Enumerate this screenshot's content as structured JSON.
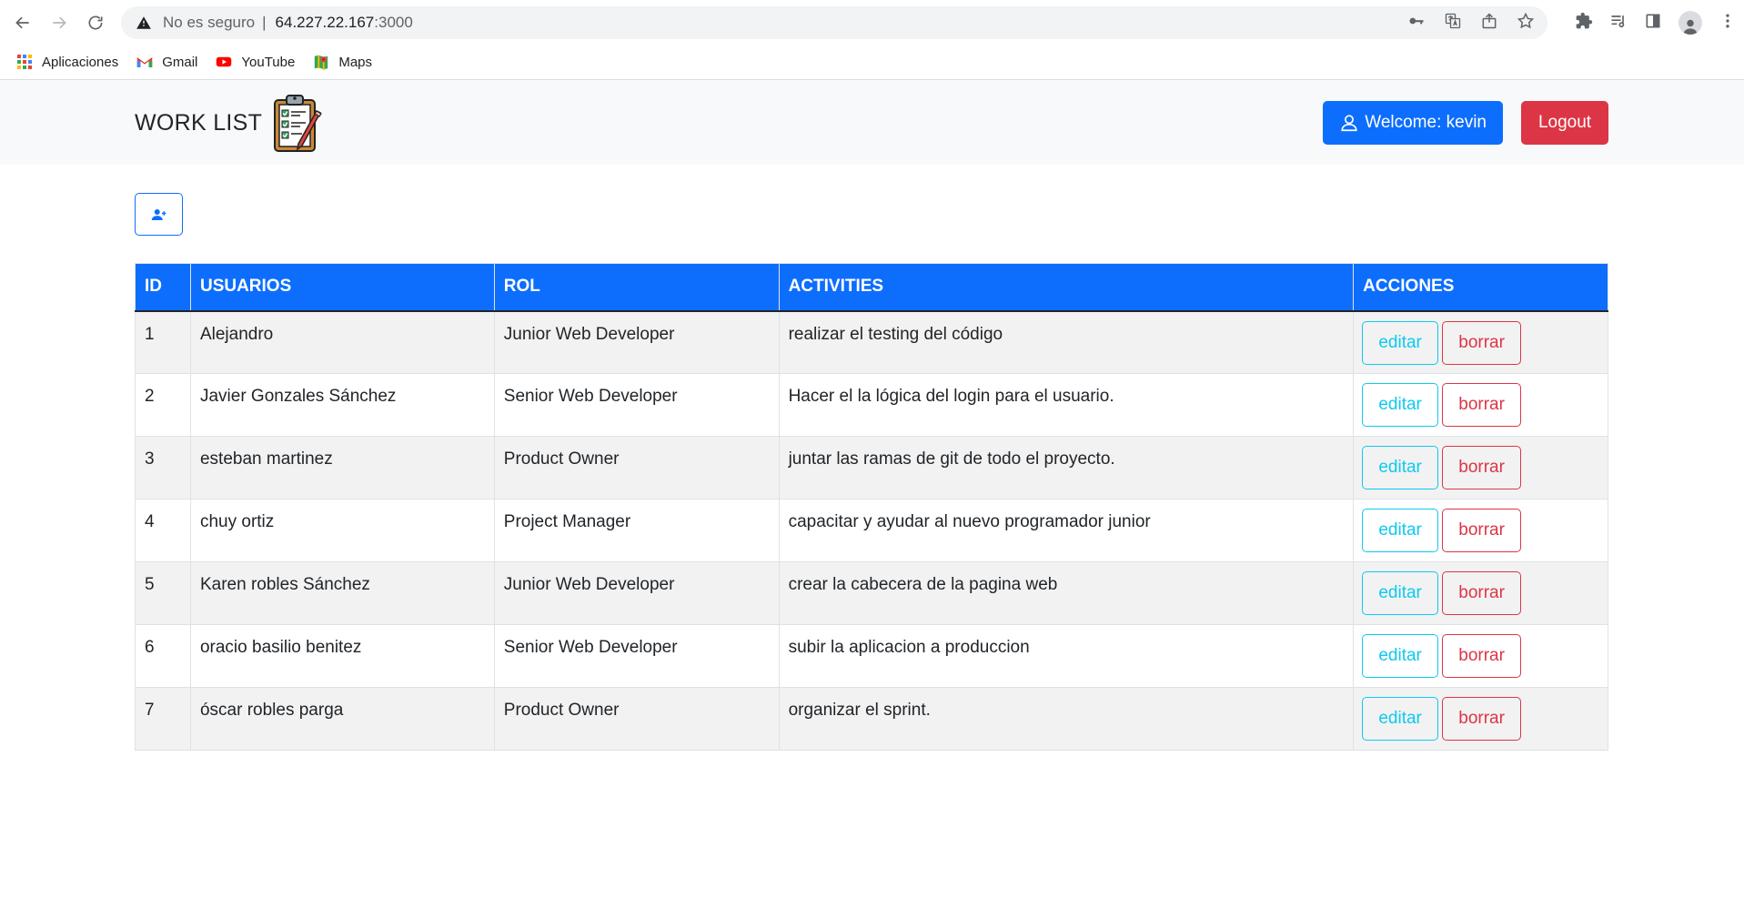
{
  "browser": {
    "security_label": "No es seguro",
    "separator": "|",
    "url_host": "64.227.22.167",
    "url_port": ":3000",
    "bookmarks": [
      {
        "label": "Aplicaciones",
        "icon": "apps-grid-icon"
      },
      {
        "label": "Gmail",
        "icon": "gmail-icon"
      },
      {
        "label": "YouTube",
        "icon": "youtube-icon"
      },
      {
        "label": "Maps",
        "icon": "maps-icon"
      }
    ]
  },
  "navbar": {
    "brand": "WORK LIST",
    "brand_icon": "clipboard-checklist-icon",
    "welcome_label": "Welcome: kevin",
    "logout_label": "Logout"
  },
  "colors": {
    "primary": "#0d6efd",
    "danger": "#dc3545",
    "info": "#0dcaf0",
    "navbar_bg": "#f8f9fa",
    "row_stripe": "#f2f2f2"
  },
  "table": {
    "headers": [
      "ID",
      "USUARIOS",
      "ROL",
      "ACTIVITIES",
      "ACCIONES"
    ],
    "edit_label": "editar",
    "delete_label": "borrar",
    "rows": [
      {
        "id": "1",
        "usuario": "Alejandro",
        "rol": "Junior Web Developer",
        "activity": "realizar el testing del código"
      },
      {
        "id": "2",
        "usuario": "Javier Gonzales Sánchez",
        "rol": "Senior Web Developer",
        "activity": "Hacer el la lógica del login para el usuario."
      },
      {
        "id": "3",
        "usuario": "esteban martinez",
        "rol": "Product Owner",
        "activity": "juntar las ramas de git de todo el proyecto."
      },
      {
        "id": "4",
        "usuario": "chuy ortiz",
        "rol": "Project Manager",
        "activity": "capacitar y ayudar al nuevo programador junior"
      },
      {
        "id": "5",
        "usuario": "Karen robles Sánchez",
        "rol": "Junior Web Developer",
        "activity": "crear la cabecera de la pagina web"
      },
      {
        "id": "6",
        "usuario": "oracio basilio benitez",
        "rol": "Senior Web Developer",
        "activity": "subir la aplicacion a produccion"
      },
      {
        "id": "7",
        "usuario": "óscar robles parga",
        "rol": "Product Owner",
        "activity": "organizar el sprint."
      }
    ]
  }
}
